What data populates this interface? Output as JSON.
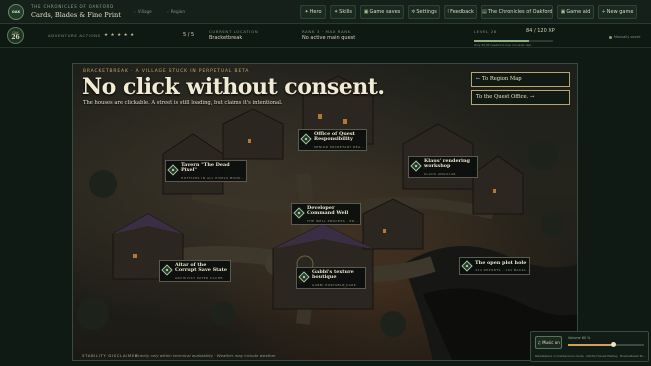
{
  "app": {
    "logo_text": "OAK",
    "subtitle": "THE CHRONICLES OF OAKFORD",
    "title": "Cards, Blades & Fine Print"
  },
  "breadcrumbs": [
    "Village",
    "Region"
  ],
  "nav": [
    {
      "icon": "✦",
      "label": "Hero"
    },
    {
      "icon": "✦",
      "label": "Skills"
    },
    {
      "icon": "▣",
      "label": "Game saves"
    },
    {
      "icon": "✲",
      "label": "Settings"
    },
    {
      "icon": "!",
      "label": "Feedback"
    },
    {
      "icon": "▤",
      "label": "The Chronicles of Oakford"
    },
    {
      "icon": "▣",
      "label": "Game aid"
    },
    {
      "icon": "+",
      "label": "New game"
    }
  ],
  "status": {
    "day_label": "DAY",
    "day_number": "26",
    "actions_label": "ADVENTURE ACTIONS",
    "actions_stars": "★ ★ ★ ★ ★",
    "actions_count": "5 / 5",
    "location_label": "CURRENT LOCATION",
    "location_value": "Bracketbreak",
    "rank_label": "RANK 3 · MAX RANK",
    "rank_value": "No active main quest",
    "level_label": "LEVEL 26",
    "xp_value": "84 / 120 XP",
    "xp_fraction": 0.7,
    "xp_note": "Only 36 XP needed to rise. (no level cap)",
    "save_label": "Manually saved"
  },
  "scene": {
    "kicker": "BRACKETBREAK · A VILLAGE STUCK IN PERPETUAL BETA",
    "headline": "No click without consent.",
    "lede": "The houses are clickable. A street is still loading, but claims it's intentional.",
    "links": [
      "← To Region Map",
      "To the Quest Office. →"
    ],
    "note_key": "STABILITY DISCLAIMER",
    "note_text": "Gravity only within technical availability · Weather may include weather"
  },
  "hotspots": [
    {
      "title": "Tavern \"The Dead\nPixel\"",
      "sub": "HOTFIXES IN ALL PIXELS BOOK..."
    },
    {
      "title": "Office of Quest\nResponsibility",
      "sub": "SENIOR SECRETARY REA..."
    },
    {
      "title": "Klaus' rendering\nworkshop",
      "sub": "KLAUS ANGULAR"
    },
    {
      "title": "Developer\nCommand Well",
      "sub": "THE WELL PROCESS · ER..."
    },
    {
      "title": "Altar of the\nCorrupt Save State",
      "sub": "ARCHIVIST PATER CACHE"
    },
    {
      "title": "Gabbi's texture\nboutique",
      "sub": "GABBI PORTABLE CARE"
    },
    {
      "title": "The open plot hole",
      "sub": "314 REPORTS · 101 BACKL..."
    }
  ],
  "music": {
    "button_label": "♫ Music on",
    "volume_label": "Volume 60 %",
    "volume_fraction": 0.6,
    "now_playing": "Marketplace in maintenance mode · Oakford Quest Medley · Bracketbreak Ro..."
  }
}
